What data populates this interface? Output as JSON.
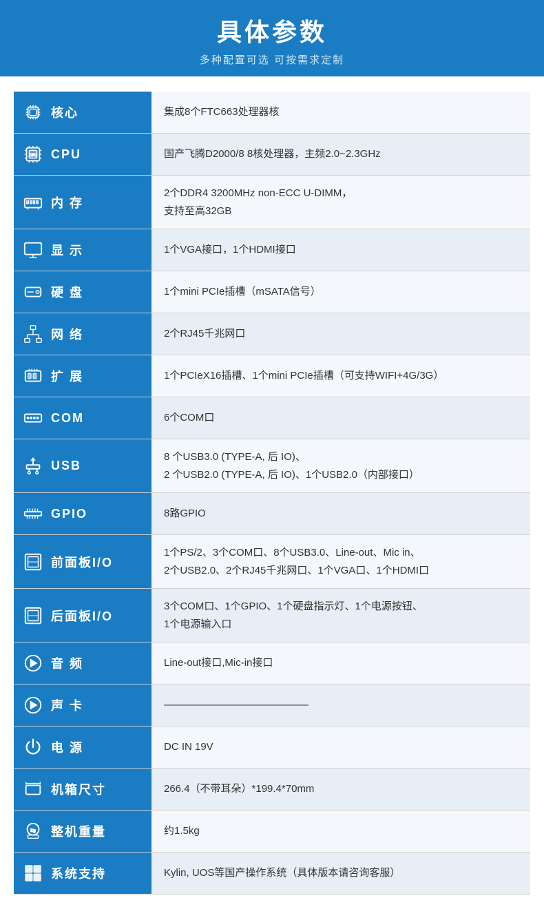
{
  "header": {
    "title": "具体参数",
    "subtitle": "多种配置可选 可按需求定制"
  },
  "rows": [
    {
      "id": "core",
      "icon": "chip",
      "label": "核心",
      "value": "集成8个FTC663处理器核"
    },
    {
      "id": "cpu",
      "icon": "cpu",
      "label": "CPU",
      "value": "国产飞腾D2000/8  8核处理器，主频2.0~2.3GHz"
    },
    {
      "id": "memory",
      "icon": "ram",
      "label": "内 存",
      "value": "2个DDR4 3200MHz non-ECC U-DIMM，\n支持至高32GB"
    },
    {
      "id": "display",
      "icon": "monitor",
      "label": "显 示",
      "value": "1个VGA接口，1个HDMI接口"
    },
    {
      "id": "storage",
      "icon": "hdd",
      "label": "硬 盘",
      "value": "1个mini PCIe插槽（mSATA信号）"
    },
    {
      "id": "network",
      "icon": "network",
      "label": "网 络",
      "value": "2个RJ45千兆网口"
    },
    {
      "id": "expansion",
      "icon": "expansion",
      "label": "扩 展",
      "value": "1个PCIeX16插槽、1个mini PCIe插槽（可支持WIFI+4G/3G）"
    },
    {
      "id": "com",
      "icon": "com",
      "label": "COM",
      "value": "6个COM口"
    },
    {
      "id": "usb",
      "icon": "usb",
      "label": "USB",
      "value": "8 个USB3.0 (TYPE-A, 后 IO)、\n2 个USB2.0 (TYPE-A, 后 IO)、1个USB2.0（内部接口）"
    },
    {
      "id": "gpio",
      "icon": "gpio",
      "label": "GPIO",
      "value": "8路GPIO"
    },
    {
      "id": "frontpanel",
      "icon": "panel",
      "label": "前面板I/O",
      "value": "1个PS/2、3个COM口、8个USB3.0、Line-out、Mic in、\n2个USB2.0、2个RJ45千兆网口、1个VGA口、1个HDMI口"
    },
    {
      "id": "rearpanel",
      "icon": "panel",
      "label": "后面板I/O",
      "value": "3个COM口、1个GPIO、1个硬盘指示灯、1个电源按钮、\n1个电源输入口"
    },
    {
      "id": "audio",
      "icon": "audio",
      "label": "音 频",
      "value": "Line-out接口,Mic-in接口"
    },
    {
      "id": "soundcard",
      "icon": "audio",
      "label": "声 卡",
      "value": "——————————————"
    },
    {
      "id": "power",
      "icon": "power",
      "label": "电 源",
      "value": "DC IN 19V"
    },
    {
      "id": "dimensions",
      "icon": "dimensions",
      "label": "机箱尺寸",
      "value": "266.4（不带耳朵）*199.4*70mm"
    },
    {
      "id": "weight",
      "icon": "weight",
      "label": "整机重量",
      "value": "约1.5kg"
    },
    {
      "id": "os",
      "icon": "windows",
      "label": "系统支持",
      "value": "Kylin, UOS等国产操作系统（具体版本请咨询客服）"
    }
  ]
}
